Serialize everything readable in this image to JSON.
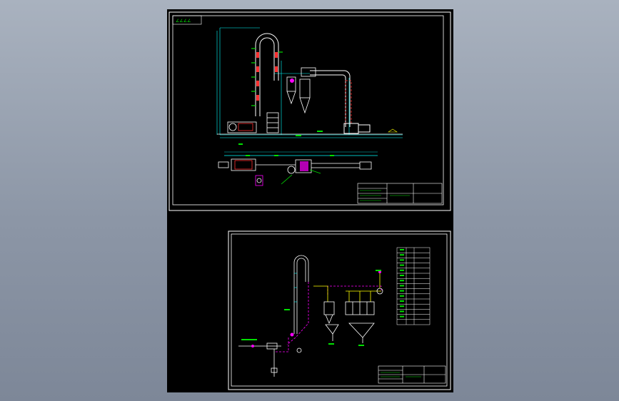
{
  "viewer": {
    "background": "#97a0b0",
    "canvas_color": "#000000"
  },
  "sheets": [
    {
      "name": "equipment-layout",
      "frame_color": "#ffffff",
      "stamp_marks": [
        "∠∠∠∠"
      ],
      "colors": {
        "cyan": "#00ffff",
        "white": "#ffffff",
        "red": "#ff3030",
        "green": "#00e000",
        "magenta": "#ff00ff",
        "yellow": "#ffff00"
      }
    },
    {
      "name": "process-flow",
      "frame_color": "#ffffff",
      "legend_rows": 15,
      "colors": {
        "cyan": "#00ffff",
        "white": "#ffffff",
        "magenta": "#ff00ff",
        "yellow": "#ffff00",
        "green": "#00e000"
      }
    }
  ]
}
